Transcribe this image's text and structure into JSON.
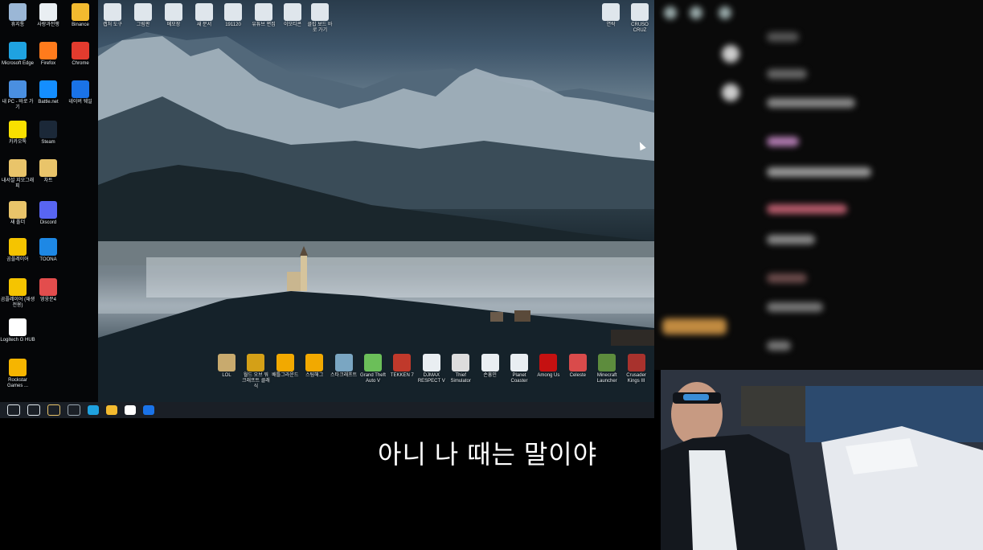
{
  "left_icons": [
    {
      "label": "휴지통",
      "icon": "recycle-bin-icon",
      "color": "#9bb7d6"
    },
    {
      "label": "사랑과전쟁",
      "icon": "file-icon",
      "color": "#e9eef2"
    },
    {
      "label": "Binance",
      "icon": "binance-icon",
      "color": "#f3ba2f"
    },
    {
      "label": "Microsoft Edge",
      "icon": "edge-icon",
      "color": "#1fa2e0"
    },
    {
      "label": "Firefox",
      "icon": "firefox-icon",
      "color": "#ff7b1c"
    },
    {
      "label": "Chrome",
      "icon": "chrome-icon",
      "color": "#e33b2e"
    },
    {
      "label": "내 PC - 바로 가기",
      "icon": "pc-icon",
      "color": "#4a8fe0"
    },
    {
      "label": "Battle.net",
      "icon": "battlenet-icon",
      "color": "#148eff"
    },
    {
      "label": "네이버 웨일",
      "icon": "whale-icon",
      "color": "#1a73e8"
    },
    {
      "label": "카카오톡",
      "icon": "kakaotalk-icon",
      "color": "#f9e000"
    },
    {
      "label": "Steam",
      "icon": "steam-icon",
      "color": "#1b2838"
    },
    {
      "label": "내서설 지오그래피",
      "icon": "folder-shortcut-icon",
      "color": "#e9c46a"
    },
    {
      "label": "차트",
      "icon": "folder-shortcut-icon",
      "color": "#e9c46a"
    },
    {
      "label": "새 폴더",
      "icon": "folder-icon",
      "color": "#e9c46a"
    },
    {
      "label": "Discord",
      "icon": "discord-icon",
      "color": "#5865f2"
    },
    {
      "label": "곰플레이어",
      "icon": "gomplayer-icon",
      "color": "#f5c400"
    },
    {
      "label": "TOONA",
      "icon": "toona-icon",
      "color": "#1e88e5"
    },
    {
      "label": "곰플레이어 (재생 전용)",
      "icon": "gomplayer-icon",
      "color": "#f5c400"
    },
    {
      "label": "영웅문4",
      "icon": "hero-icon",
      "color": "#e34d4d"
    },
    {
      "label": "Logitech G HUB",
      "icon": "logitech-icon",
      "color": "#ffffff"
    },
    {
      "label": "Rockstar Games ...",
      "icon": "rockstar-icon",
      "color": "#f6b500"
    }
  ],
  "top_icons": [
    {
      "label": "캡처 도구",
      "icon": "snipping-icon"
    },
    {
      "label": "그림판",
      "icon": "paint-icon"
    },
    {
      "label": "메모장",
      "icon": "notepad-icon"
    },
    {
      "label": "새 문서",
      "icon": "document-icon"
    },
    {
      "label": "191120",
      "icon": "folder-icon"
    },
    {
      "label": "유튜브 편집",
      "icon": "folder-icon"
    },
    {
      "label": "이모티콘",
      "icon": "file-icon"
    },
    {
      "label": "클립 보드 바로 가기",
      "icon": "shortcut-icon"
    },
    {
      "label": "연락",
      "icon": "app-icon"
    },
    {
      "label": "CRUSO CRUZ",
      "icon": "game-icon"
    }
  ],
  "bottom_icons": [
    {
      "label": "LOL",
      "icon": "lol-icon",
      "color": "#c8aa6e"
    },
    {
      "label": "월드 오브 워크래프트 클래식",
      "icon": "wow-icon",
      "color": "#d4a017"
    },
    {
      "label": "배틀그라운드",
      "icon": "pubg-icon",
      "color": "#f2a900"
    },
    {
      "label": "스팀해그",
      "icon": "pubg-icon",
      "color": "#f2a900"
    },
    {
      "label": "스타크래프트",
      "icon": "starcraft-icon",
      "color": "#7aa6c2"
    },
    {
      "label": "Grand Theft Auto V",
      "icon": "gta-icon",
      "color": "#6bbf59"
    },
    {
      "label": "TEKKEN 7",
      "icon": "tekken-icon",
      "color": "#c0392b"
    },
    {
      "label": "DJMAX RESPECT V",
      "icon": "file-icon",
      "color": "#e9eef2"
    },
    {
      "label": "Thief Simulator",
      "icon": "thief-icon",
      "color": "#dddddd"
    },
    {
      "label": "손흥민",
      "icon": "file-icon",
      "color": "#e9eef2"
    },
    {
      "label": "Planet Coaster",
      "icon": "file-icon",
      "color": "#e9eef2"
    },
    {
      "label": "Among Us",
      "icon": "amongus-icon",
      "color": "#c51111"
    },
    {
      "label": "Celeste",
      "icon": "celeste-icon",
      "color": "#d94b4b"
    },
    {
      "label": "Minecraft Launcher",
      "icon": "minecraft-icon",
      "color": "#5d8c3d"
    },
    {
      "label": "Crusader Kings III",
      "icon": "ck3-icon",
      "color": "#a8322d"
    }
  ],
  "taskbar": [
    "windows-start-icon",
    "task-view-icon",
    "file-explorer-icon",
    "store-icon",
    "edge-icon",
    "binance-icon",
    "logitech-icon",
    "whale-icon"
  ],
  "subtitle": "아니 나 때는 말이야"
}
